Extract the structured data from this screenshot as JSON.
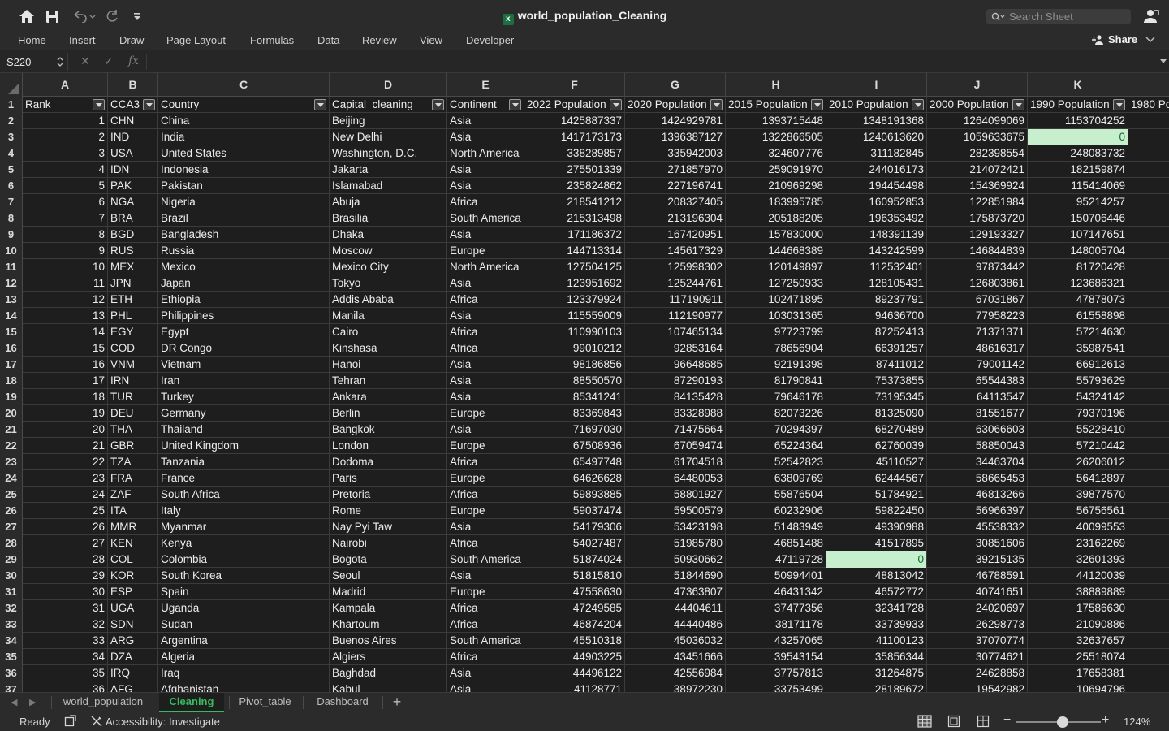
{
  "window": {
    "title": "world_population_Cleaning",
    "search_placeholder": "Search Sheet",
    "icons": [
      "home-icon",
      "save-icon",
      "undo-icon",
      "redo-icon",
      "customize-toolbar-icon",
      "account-icon"
    ]
  },
  "ribbon": {
    "tabs": [
      "Home",
      "Insert",
      "Draw",
      "Page Layout",
      "Formulas",
      "Data",
      "Review",
      "View",
      "Developer"
    ],
    "share_label": "Share"
  },
  "formula_bar": {
    "name_box": "S220",
    "fx_label": "fx",
    "formula": ""
  },
  "columns": [
    "A",
    "B",
    "C",
    "D",
    "E",
    "F",
    "G",
    "H",
    "I",
    "J",
    "K",
    ""
  ],
  "header_row": {
    "row_number": "1",
    "cells": [
      "Rank",
      "CCA3",
      "Country",
      "Capital_cleaning",
      "Continent",
      "2022 Population",
      "2020 Population",
      "2015 Population",
      "2010 Population",
      "2000 Population",
      "1990 Population",
      "1980 Po"
    ]
  },
  "rows": [
    {
      "n": "2",
      "rank": "1",
      "cca3": "CHN",
      "country": "China",
      "capital": "Beijing",
      "continent": "Asia",
      "p2022": "1425887337",
      "p2020": "1424929781",
      "p2015": "1393715448",
      "p2010": "1348191368",
      "p2000": "1264099069",
      "p1990": "1153704252"
    },
    {
      "n": "3",
      "rank": "2",
      "cca3": "IND",
      "country": "India",
      "capital": "New Delhi",
      "continent": "Asia",
      "p2022": "1417173173",
      "p2020": "1396387127",
      "p2015": "1322866505",
      "p2010": "1240613620",
      "p2000": "1059633675",
      "p1990": "0"
    },
    {
      "n": "4",
      "rank": "3",
      "cca3": "USA",
      "country": "United States",
      "capital": "Washington, D.C.",
      "continent": "North America",
      "p2022": "338289857",
      "p2020": "335942003",
      "p2015": "324607776",
      "p2010": "311182845",
      "p2000": "282398554",
      "p1990": "248083732"
    },
    {
      "n": "5",
      "rank": "4",
      "cca3": "IDN",
      "country": "Indonesia",
      "capital": "Jakarta",
      "continent": "Asia",
      "p2022": "275501339",
      "p2020": "271857970",
      "p2015": "259091970",
      "p2010": "244016173",
      "p2000": "214072421",
      "p1990": "182159874"
    },
    {
      "n": "6",
      "rank": "5",
      "cca3": "PAK",
      "country": "Pakistan",
      "capital": "Islamabad",
      "continent": "Asia",
      "p2022": "235824862",
      "p2020": "227196741",
      "p2015": "210969298",
      "p2010": "194454498",
      "p2000": "154369924",
      "p1990": "115414069"
    },
    {
      "n": "7",
      "rank": "6",
      "cca3": "NGA",
      "country": "Nigeria",
      "capital": "Abuja",
      "continent": "Africa",
      "p2022": "218541212",
      "p2020": "208327405",
      "p2015": "183995785",
      "p2010": "160952853",
      "p2000": "122851984",
      "p1990": "95214257"
    },
    {
      "n": "8",
      "rank": "7",
      "cca3": "BRA",
      "country": "Brazil",
      "capital": "Brasilia",
      "continent": "South America",
      "p2022": "215313498",
      "p2020": "213196304",
      "p2015": "205188205",
      "p2010": "196353492",
      "p2000": "175873720",
      "p1990": "150706446"
    },
    {
      "n": "9",
      "rank": "8",
      "cca3": "BGD",
      "country": "Bangladesh",
      "capital": "Dhaka",
      "continent": "Asia",
      "p2022": "171186372",
      "p2020": "167420951",
      "p2015": "157830000",
      "p2010": "148391139",
      "p2000": "129193327",
      "p1990": "107147651"
    },
    {
      "n": "10",
      "rank": "9",
      "cca3": "RUS",
      "country": "Russia",
      "capital": "Moscow",
      "continent": "Europe",
      "p2022": "144713314",
      "p2020": "145617329",
      "p2015": "144668389",
      "p2010": "143242599",
      "p2000": "146844839",
      "p1990": "148005704"
    },
    {
      "n": "11",
      "rank": "10",
      "cca3": "MEX",
      "country": "Mexico",
      "capital": "Mexico City",
      "continent": "North America",
      "p2022": "127504125",
      "p2020": "125998302",
      "p2015": "120149897",
      "p2010": "112532401",
      "p2000": "97873442",
      "p1990": "81720428"
    },
    {
      "n": "12",
      "rank": "11",
      "cca3": "JPN",
      "country": "Japan",
      "capital": "Tokyo",
      "continent": "Asia",
      "p2022": "123951692",
      "p2020": "125244761",
      "p2015": "127250933",
      "p2010": "128105431",
      "p2000": "126803861",
      "p1990": "123686321"
    },
    {
      "n": "13",
      "rank": "12",
      "cca3": "ETH",
      "country": "Ethiopia",
      "capital": "Addis Ababa",
      "continent": "Africa",
      "p2022": "123379924",
      "p2020": "117190911",
      "p2015": "102471895",
      "p2010": "89237791",
      "p2000": "67031867",
      "p1990": "47878073"
    },
    {
      "n": "14",
      "rank": "13",
      "cca3": "PHL",
      "country": "Philippines",
      "capital": "Manila",
      "continent": "Asia",
      "p2022": "115559009",
      "p2020": "112190977",
      "p2015": "103031365",
      "p2010": "94636700",
      "p2000": "77958223",
      "p1990": "61558898"
    },
    {
      "n": "15",
      "rank": "14",
      "cca3": "EGY",
      "country": "Egypt",
      "capital": "Cairo",
      "continent": "Africa",
      "p2022": "110990103",
      "p2020": "107465134",
      "p2015": "97723799",
      "p2010": "87252413",
      "p2000": "71371371",
      "p1990": "57214630"
    },
    {
      "n": "16",
      "rank": "15",
      "cca3": "COD",
      "country": "DR Congo",
      "capital": "Kinshasa",
      "continent": "Africa",
      "p2022": "99010212",
      "p2020": "92853164",
      "p2015": "78656904",
      "p2010": "66391257",
      "p2000": "48616317",
      "p1990": "35987541"
    },
    {
      "n": "17",
      "rank": "16",
      "cca3": "VNM",
      "country": "Vietnam",
      "capital": "Hanoi",
      "continent": "Asia",
      "p2022": "98186856",
      "p2020": "96648685",
      "p2015": "92191398",
      "p2010": "87411012",
      "p2000": "79001142",
      "p1990": "66912613"
    },
    {
      "n": "18",
      "rank": "17",
      "cca3": "IRN",
      "country": "Iran",
      "capital": "Tehran",
      "continent": "Asia",
      "p2022": "88550570",
      "p2020": "87290193",
      "p2015": "81790841",
      "p2010": "75373855",
      "p2000": "65544383",
      "p1990": "55793629"
    },
    {
      "n": "19",
      "rank": "18",
      "cca3": "TUR",
      "country": "Turkey",
      "capital": "Ankara",
      "continent": "Asia",
      "p2022": "85341241",
      "p2020": "84135428",
      "p2015": "79646178",
      "p2010": "73195345",
      "p2000": "64113547",
      "p1990": "54324142"
    },
    {
      "n": "20",
      "rank": "19",
      "cca3": "DEU",
      "country": "Germany",
      "capital": "Berlin",
      "continent": "Europe",
      "p2022": "83369843",
      "p2020": "83328988",
      "p2015": "82073226",
      "p2010": "81325090",
      "p2000": "81551677",
      "p1990": "79370196"
    },
    {
      "n": "21",
      "rank": "20",
      "cca3": "THA",
      "country": "Thailand",
      "capital": "Bangkok",
      "continent": "Asia",
      "p2022": "71697030",
      "p2020": "71475664",
      "p2015": "70294397",
      "p2010": "68270489",
      "p2000": "63066603",
      "p1990": "55228410"
    },
    {
      "n": "22",
      "rank": "21",
      "cca3": "GBR",
      "country": "United Kingdom",
      "capital": "London",
      "continent": "Europe",
      "p2022": "67508936",
      "p2020": "67059474",
      "p2015": "65224364",
      "p2010": "62760039",
      "p2000": "58850043",
      "p1990": "57210442"
    },
    {
      "n": "23",
      "rank": "22",
      "cca3": "TZA",
      "country": "Tanzania",
      "capital": "Dodoma",
      "continent": "Africa",
      "p2022": "65497748",
      "p2020": "61704518",
      "p2015": "52542823",
      "p2010": "45110527",
      "p2000": "34463704",
      "p1990": "26206012"
    },
    {
      "n": "24",
      "rank": "23",
      "cca3": "FRA",
      "country": "France",
      "capital": "Paris",
      "continent": "Europe",
      "p2022": "64626628",
      "p2020": "64480053",
      "p2015": "63809769",
      "p2010": "62444567",
      "p2000": "58665453",
      "p1990": "56412897"
    },
    {
      "n": "25",
      "rank": "24",
      "cca3": "ZAF",
      "country": "South Africa",
      "capital": "Pretoria",
      "continent": "Africa",
      "p2022": "59893885",
      "p2020": "58801927",
      "p2015": "55876504",
      "p2010": "51784921",
      "p2000": "46813266",
      "p1990": "39877570"
    },
    {
      "n": "26",
      "rank": "25",
      "cca3": "ITA",
      "country": "Italy",
      "capital": "Rome",
      "continent": "Europe",
      "p2022": "59037474",
      "p2020": "59500579",
      "p2015": "60232906",
      "p2010": "59822450",
      "p2000": "56966397",
      "p1990": "56756561"
    },
    {
      "n": "27",
      "rank": "26",
      "cca3": "MMR",
      "country": "Myanmar",
      "capital": "Nay Pyi Taw",
      "continent": "Asia",
      "p2022": "54179306",
      "p2020": "53423198",
      "p2015": "51483949",
      "p2010": "49390988",
      "p2000": "45538332",
      "p1990": "40099553"
    },
    {
      "n": "28",
      "rank": "27",
      "cca3": "KEN",
      "country": "Kenya",
      "capital": "Nairobi",
      "continent": "Africa",
      "p2022": "54027487",
      "p2020": "51985780",
      "p2015": "46851488",
      "p2010": "41517895",
      "p2000": "30851606",
      "p1990": "23162269"
    },
    {
      "n": "29",
      "rank": "28",
      "cca3": "COL",
      "country": "Colombia",
      "capital": "Bogota",
      "continent": "South America",
      "p2022": "51874024",
      "p2020": "50930662",
      "p2015": "47119728",
      "p2010": "0",
      "p2000": "39215135",
      "p1990": "32601393"
    },
    {
      "n": "30",
      "rank": "29",
      "cca3": "KOR",
      "country": "South Korea",
      "capital": "Seoul",
      "continent": "Asia",
      "p2022": "51815810",
      "p2020": "51844690",
      "p2015": "50994401",
      "p2010": "48813042",
      "p2000": "46788591",
      "p1990": "44120039"
    },
    {
      "n": "31",
      "rank": "30",
      "cca3": "ESP",
      "country": "Spain",
      "capital": "Madrid",
      "continent": "Europe",
      "p2022": "47558630",
      "p2020": "47363807",
      "p2015": "46431342",
      "p2010": "46572772",
      "p2000": "40741651",
      "p1990": "38889889"
    },
    {
      "n": "32",
      "rank": "31",
      "cca3": "UGA",
      "country": "Uganda",
      "capital": "Kampala",
      "continent": "Africa",
      "p2022": "47249585",
      "p2020": "44404611",
      "p2015": "37477356",
      "p2010": "32341728",
      "p2000": "24020697",
      "p1990": "17586630"
    },
    {
      "n": "33",
      "rank": "32",
      "cca3": "SDN",
      "country": "Sudan",
      "capital": "Khartoum",
      "continent": "Africa",
      "p2022": "46874204",
      "p2020": "44440486",
      "p2015": "38171178",
      "p2010": "33739933",
      "p2000": "26298773",
      "p1990": "21090886"
    },
    {
      "n": "34",
      "rank": "33",
      "cca3": "ARG",
      "country": "Argentina",
      "capital": "Buenos Aires",
      "continent": "South America",
      "p2022": "45510318",
      "p2020": "45036032",
      "p2015": "43257065",
      "p2010": "41100123",
      "p2000": "37070774",
      "p1990": "32637657"
    },
    {
      "n": "35",
      "rank": "34",
      "cca3": "DZA",
      "country": "Algeria",
      "capital": "Algiers",
      "continent": "Africa",
      "p2022": "44903225",
      "p2020": "43451666",
      "p2015": "39543154",
      "p2010": "35856344",
      "p2000": "30774621",
      "p1990": "25518074"
    },
    {
      "n": "36",
      "rank": "35",
      "cca3": "IRQ",
      "country": "Iraq",
      "capital": "Baghdad",
      "continent": "Asia",
      "p2022": "44496122",
      "p2020": "42556984",
      "p2015": "37757813",
      "p2010": "31264875",
      "p2000": "24628858",
      "p1990": "17658381"
    },
    {
      "n": "37",
      "rank": "36",
      "cca3": "AFG",
      "country": "Afghanistan",
      "capital": "Kabul",
      "continent": "Asia",
      "p2022": "41128771",
      "p2020": "38972230",
      "p2015": "33753499",
      "p2010": "28189672",
      "p2000": "19542982",
      "p1990": "10694796"
    }
  ],
  "sheets": {
    "tabs": [
      "world_population",
      "Cleaning",
      "Pivot_table",
      "Dashboard"
    ],
    "active": "Cleaning",
    "add_label": "+"
  },
  "status": {
    "ready": "Ready",
    "accessibility": "Accessibility: Investigate",
    "zoom": "124%",
    "zoom_level": 0.24
  },
  "colors": {
    "accent": "#2fbf5f",
    "highlight_fill": "#c6efce",
    "highlight_text": "#0e6b2e"
  }
}
